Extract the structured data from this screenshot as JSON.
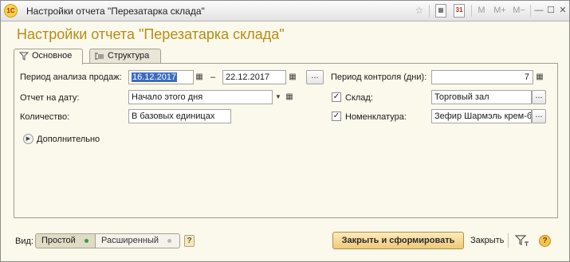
{
  "window": {
    "app_icon": "1C",
    "title": "Настройки отчета \"Перезатарка склада\"",
    "toolbar": [
      "star-icon",
      "calculator-icon",
      "calendar-icon",
      "M",
      "M+",
      "M-",
      "minimize-icon",
      "maximize-icon",
      "close-icon"
    ],
    "calendar_day": "31",
    "m_label": "M",
    "mplus_label": "M+",
    "mminus_label": "M−",
    "minimize_glyph": "—",
    "maximize_glyph": "☐",
    "close_glyph": "✕"
  },
  "heading": "Настройки отчета \"Перезатарка склада\"",
  "tabs": [
    {
      "label": "Основное",
      "icon": "filter-icon",
      "active": true
    },
    {
      "label": "Структура",
      "icon": "structure-icon",
      "active": false
    }
  ],
  "form": {
    "period_label": "Период анализа продаж:",
    "period_from": "16.12.2017",
    "period_dash": "–",
    "period_to": "22.12.2017",
    "period_more": "...",
    "control_label": "Период контроля (дни):",
    "control_value": "7",
    "date_label": "Отчет на дату:",
    "date_value": "Начало этого дня",
    "warehouse_label": "Склад:",
    "warehouse_checked": true,
    "warehouse_value": "Торговый зал",
    "quantity_label": "Количество:",
    "quantity_value": "В базовых единицах",
    "nomenclature_label": "Номенклатура:",
    "nomenclature_checked": true,
    "nomenclature_value": "Зефир Шармэль крем-брюле",
    "more_label": "Дополнительно",
    "check_mark": "✓",
    "dots": "..."
  },
  "footer": {
    "view_label": "Вид:",
    "view_simple": "Простой",
    "view_extended": "Расширенный",
    "view_help": "?",
    "generate_button": "Закрыть и сформировать",
    "close_link": "Закрыть",
    "help_glyph": "?"
  },
  "colors": {
    "heading": "#b58d13",
    "selection": "#3c6cbf",
    "primary_button": "#f0c977",
    "active_dot": "#2ea043"
  }
}
